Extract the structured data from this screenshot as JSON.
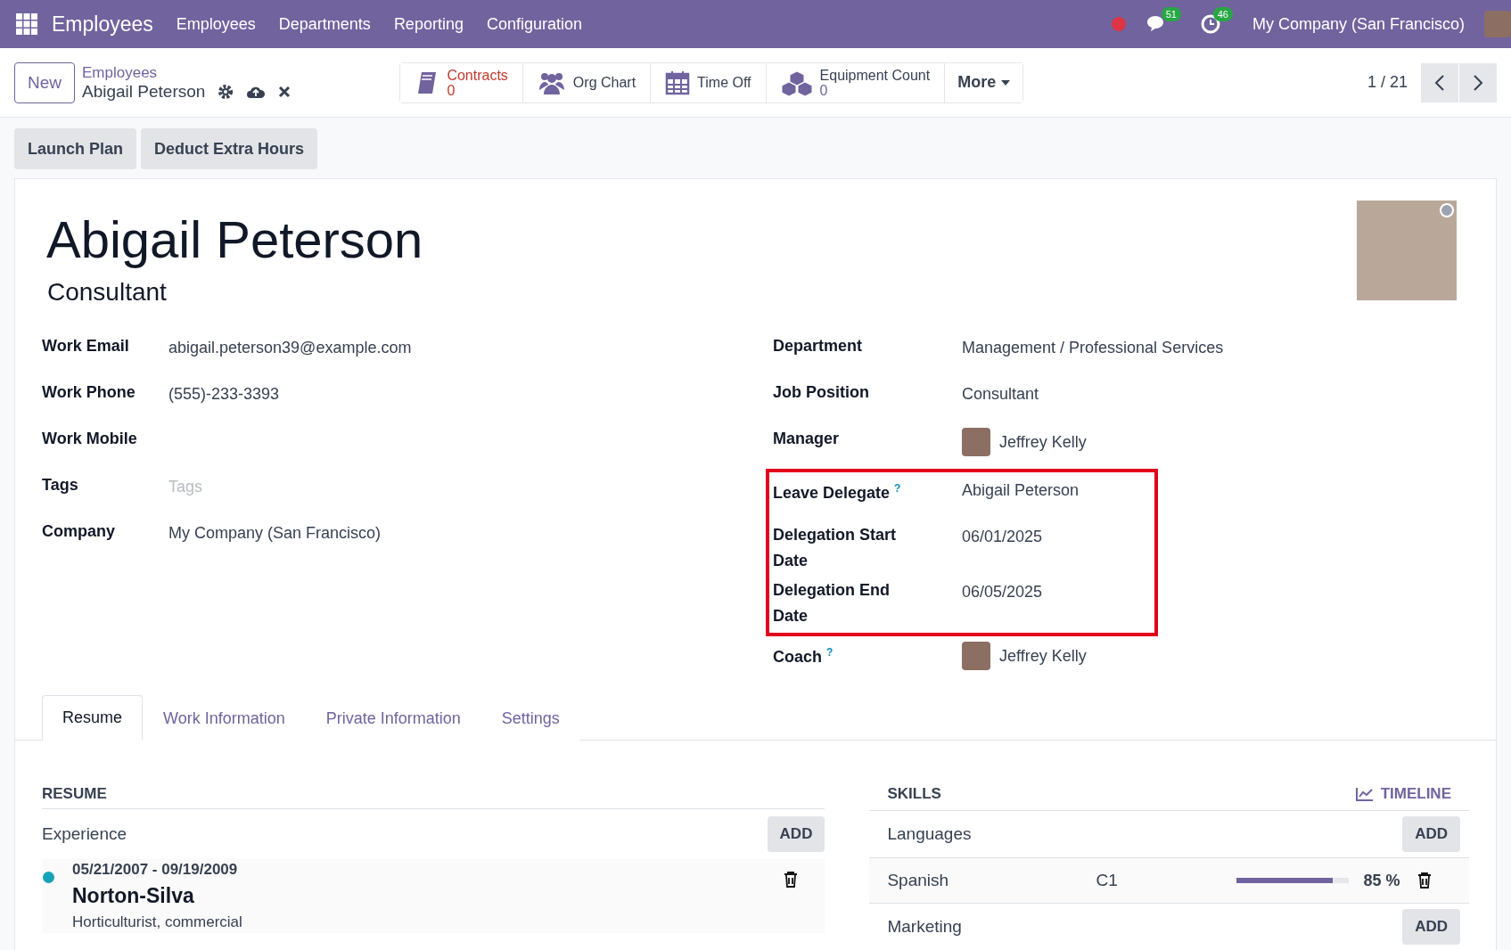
{
  "navbar": {
    "app": "Employees",
    "menu": [
      "Employees",
      "Departments",
      "Reporting",
      "Configuration"
    ],
    "messages_badge": "51",
    "activities_badge": "46",
    "company": "My Company (San Francisco)"
  },
  "control_panel": {
    "new_button": "New",
    "breadcrumb": "Employees",
    "record": "Abigail Peterson",
    "smart_buttons": [
      {
        "kind": "counter",
        "label": "Contracts",
        "value": "0",
        "alert": true
      },
      {
        "kind": "plain",
        "label": "Org Chart",
        "alert": false
      },
      {
        "kind": "plain",
        "label": "Time Off",
        "alert": false
      },
      {
        "kind": "counter",
        "label": "Equipment Count",
        "value": "0",
        "alert": false
      }
    ],
    "more": "More",
    "pager": "1 / 21"
  },
  "header_buttons": [
    "Launch Plan",
    "Deduct Extra Hours"
  ],
  "employee": {
    "name": "Abigail Peterson",
    "job_title": "Consultant"
  },
  "left_fields": [
    {
      "label": "Work Email",
      "value": "abigail.peterson39@example.com"
    },
    {
      "label": "Work Phone",
      "value": "(555)-233-3393"
    },
    {
      "label": "Work Mobile"
    },
    {
      "label": "Tags",
      "placeholder": "Tags"
    },
    {
      "label": "Company",
      "value": "My Company (San Francisco)"
    }
  ],
  "right_fields": [
    {
      "label": "Department",
      "value": "Management / Professional Services",
      "highlighted": false
    },
    {
      "label": "Job Position",
      "value": "Consultant",
      "highlighted": false
    },
    {
      "label": "Manager",
      "value": "Jeffrey Kelly",
      "avatar": true,
      "highlighted": false
    },
    {
      "label": "Leave Delegate",
      "help": "?",
      "value": "Abigail Peterson",
      "highlighted": true
    },
    {
      "label": "Delegation Start Date",
      "value": "06/01/2025",
      "highlighted": true
    },
    {
      "label": "Delegation End Date",
      "value": "06/05/2025",
      "highlighted": true
    },
    {
      "label": "Coach",
      "help": "?",
      "value": "Jeffrey Kelly",
      "avatar": true,
      "highlighted": false
    }
  ],
  "tabs": [
    {
      "label": "Resume",
      "selected": true
    },
    {
      "label": "Work Information",
      "selected": false
    },
    {
      "label": "Private Information",
      "selected": false
    },
    {
      "label": "Settings",
      "selected": false
    }
  ],
  "resume": {
    "title": "RESUME",
    "groups": [
      {
        "name": "Experience",
        "add": "ADD",
        "lines": [
          {
            "dates": "05/21/2007 - 09/19/2009",
            "title": "Norton-Silva",
            "description": "Horticulturist, commercial"
          }
        ]
      }
    ]
  },
  "skills": {
    "title": "SKILLS",
    "timeline": "TIMELINE",
    "groups": [
      {
        "name": "Languages",
        "add": "ADD",
        "skills": [
          {
            "name": "Spanish",
            "level_name": "C1",
            "level": 0.85,
            "percent": "85 %"
          }
        ]
      },
      {
        "name": "Marketing",
        "add": "ADD"
      }
    ]
  }
}
